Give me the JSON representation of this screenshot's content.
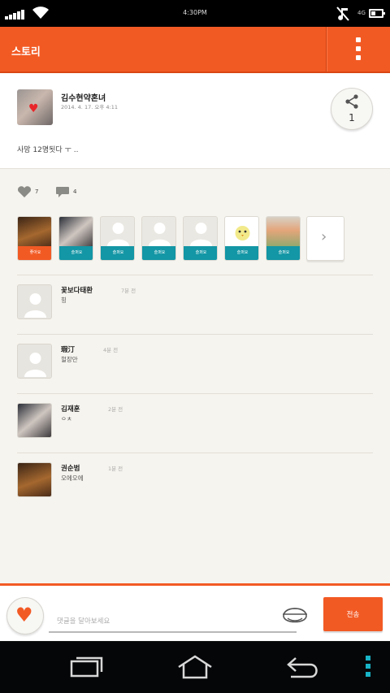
{
  "status_bar": {
    "time": "4:30PM",
    "network": "4G"
  },
  "app_bar": {
    "title": "스토리",
    "menu_icon": "overflow-menu-icon"
  },
  "post": {
    "author": "김수현약혼녀",
    "date": "2014. 4. 17. 오후 4:11",
    "content": "사망 12명됫다 ㅜ ..",
    "share_count": "1"
  },
  "stats": {
    "likes": "7",
    "comments": "4"
  },
  "likers": [
    {
      "label": "좋아요",
      "color": "orange",
      "photo": true
    },
    {
      "label": "슬퍼요",
      "color": "teal",
      "photo": true
    },
    {
      "label": "슬퍼요",
      "color": "teal",
      "photo": false
    },
    {
      "label": "슬퍼요",
      "color": "teal",
      "photo": false
    },
    {
      "label": "슬퍼요",
      "color": "teal",
      "photo": false
    },
    {
      "label": "슬퍼요",
      "color": "teal",
      "photo": "chick"
    },
    {
      "label": "슬퍼요",
      "color": "teal",
      "photo": "anime"
    }
  ],
  "comments": [
    {
      "name": "꽃보다태환",
      "time": "7분 전",
      "text": "힝"
    },
    {
      "name": "瑕汀",
      "time": "4분 전",
      "text": "헐장만"
    },
    {
      "name": "김재훈",
      "time": "2분 전",
      "text": "ㅇㅊ"
    },
    {
      "name": "권순범",
      "time": "1분 전",
      "text": "오에오에"
    }
  ],
  "comment_input": {
    "placeholder": "댓글을 달아보세요",
    "send_label": "전송"
  },
  "colors": {
    "accent": "#f25a24",
    "teal": "#1396a5"
  }
}
